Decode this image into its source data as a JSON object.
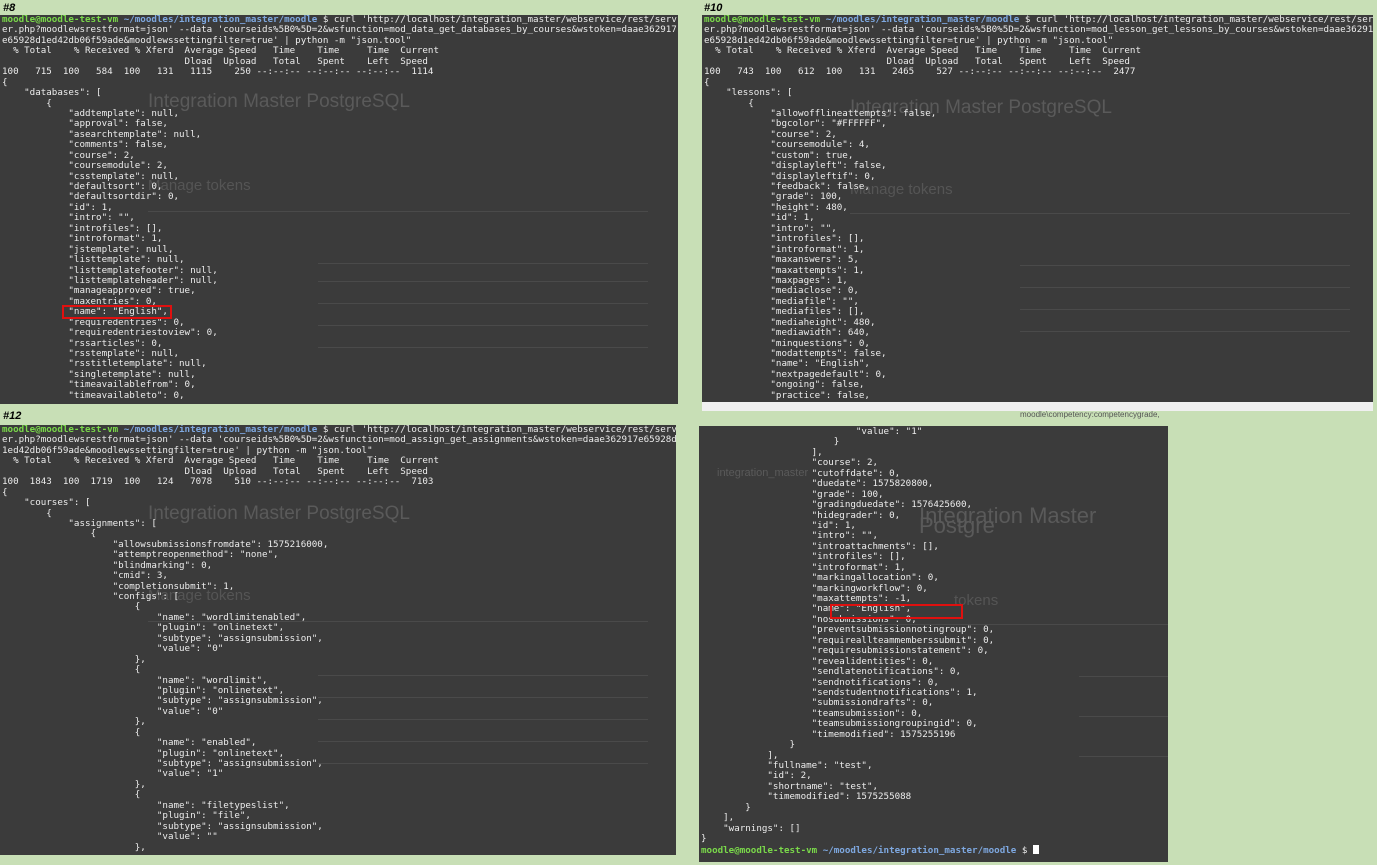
{
  "captions": {
    "p8": "#8",
    "p10": "#10",
    "p12": "#12"
  },
  "ghost": {
    "title": "Integration Master PostgreSQL",
    "heading": "Manage tokens",
    "title_short": "Integration Master Postgre",
    "heading_short": "tokens",
    "site_name": "integration_master",
    "strip_text": "moodle\\competency:competencygrade,"
  },
  "panels": {
    "p8": {
      "lines": [
        {
          "type": "prompt",
          "user": "moodle@moodle-test-vm",
          "path": "~/moodles/integration_master/moodle",
          "cmd": " $ curl 'http://localhost/integration_master/webservice/rest/serv"
        },
        {
          "text": "er.php?moodlewsrestformat=json' --data 'courseids%5B0%5D=2&wsfunction=mod_data_get_databases_by_courses&wstoken=daae362917"
        },
        {
          "text": "e65928d1ed42db06f59ade&moodlewssettingfilter=true' | python -m \"json.tool\""
        },
        {
          "text": "  % Total    % Received % Xferd  Average Speed   Time    Time     Time  Current"
        },
        {
          "text": "                                 Dload  Upload   Total   Spent    Left  Speed"
        },
        {
          "text": "100   715  100   584  100   131   1115    250 --:--:-- --:--:-- --:--:--  1114"
        },
        {
          "text": "{"
        },
        {
          "text": "    \"databases\": ["
        },
        {
          "text": "        {"
        },
        {
          "text": "            \"addtemplate\": null,"
        },
        {
          "text": "            \"approval\": false,"
        },
        {
          "text": "            \"asearchtemplate\": null,"
        },
        {
          "text": "            \"comments\": false,"
        },
        {
          "text": "            \"course\": 2,"
        },
        {
          "text": "            \"coursemodule\": 2,"
        },
        {
          "text": "            \"csstemplate\": null,"
        },
        {
          "text": "            \"defaultsort\": 0,"
        },
        {
          "text": "            \"defaultsortdir\": 0,"
        },
        {
          "text": "            \"id\": 1,"
        },
        {
          "text": "            \"intro\": \"\","
        },
        {
          "text": "            \"introfiles\": [],"
        },
        {
          "text": "            \"introformat\": 1,"
        },
        {
          "text": "            \"jstemplate\": null,"
        },
        {
          "text": "            \"listtemplate\": null,"
        },
        {
          "text": "            \"listtemplatefooter\": null,"
        },
        {
          "text": "            \"listtemplateheader\": null,"
        },
        {
          "text": "            \"manageapproved\": true,"
        },
        {
          "text": "            \"maxentries\": 0,"
        },
        {
          "text": "            \"name\": \"English\","
        },
        {
          "text": "            \"requiredentries\": 0,"
        },
        {
          "text": "            \"requiredentriestoview\": 0,"
        },
        {
          "text": "            \"rssarticles\": 0,"
        },
        {
          "text": "            \"rsstemplate\": null,"
        },
        {
          "text": "            \"rsstitletemplate\": null,"
        },
        {
          "text": "            \"singletemplate\": null,"
        },
        {
          "text": "            \"timeavailablefrom\": 0,"
        },
        {
          "text": "            \"timeavailableto\": 0,"
        }
      ]
    },
    "p10": {
      "lines": [
        {
          "type": "prompt",
          "user": "moodle@moodle-test-vm",
          "path": "~/moodles/integration_master/moodle",
          "cmd": " $ curl 'http://localhost/integration_master/webservice/rest/serv"
        },
        {
          "text": "er.php?moodlewsrestformat=json' --data 'courseids%5B0%5D=2&wsfunction=mod_lesson_get_lessons_by_courses&wstoken=daae362917"
        },
        {
          "text": "e65928d1ed42db06f59ade&moodlewssettingfilter=true' | python -m \"json.tool\""
        },
        {
          "text": "  % Total    % Received % Xferd  Average Speed   Time    Time     Time  Current"
        },
        {
          "text": "                                 Dload  Upload   Total   Spent    Left  Speed"
        },
        {
          "text": "100   743  100   612  100   131   2465    527 --:--:-- --:--:-- --:--:--  2477"
        },
        {
          "text": "{"
        },
        {
          "text": "    \"lessons\": ["
        },
        {
          "text": "        {"
        },
        {
          "text": "            \"allowofflineattempts\": false,"
        },
        {
          "text": "            \"bgcolor\": \"#FFFFFF\","
        },
        {
          "text": "            \"course\": 2,"
        },
        {
          "text": "            \"coursemodule\": 4,"
        },
        {
          "text": "            \"custom\": true,"
        },
        {
          "text": "            \"displayleft\": false,"
        },
        {
          "text": "            \"displayleftif\": 0,"
        },
        {
          "text": "            \"feedback\": false,"
        },
        {
          "text": "            \"grade\": 100,"
        },
        {
          "text": "            \"height\": 480,"
        },
        {
          "text": "            \"id\": 1,"
        },
        {
          "text": "            \"intro\": \"\","
        },
        {
          "text": "            \"introfiles\": [],"
        },
        {
          "text": "            \"introformat\": 1,"
        },
        {
          "text": "            \"maxanswers\": 5,"
        },
        {
          "text": "            \"maxattempts\": 1,"
        },
        {
          "text": "            \"maxpages\": 1,"
        },
        {
          "text": "            \"mediaclose\": 0,"
        },
        {
          "text": "            \"mediafile\": \"\","
        },
        {
          "text": "            \"mediafiles\": [],"
        },
        {
          "text": "            \"mediaheight\": 480,"
        },
        {
          "text": "            \"mediawidth\": 640,"
        },
        {
          "text": "            \"minquestions\": 0,"
        },
        {
          "text": "            \"modattempts\": false,"
        },
        {
          "text": "            \"name\": \"English\","
        },
        {
          "text": "            \"nextpagedefault\": 0,"
        },
        {
          "text": "            \"ongoing\": false,"
        },
        {
          "text": "            \"practice\": false,"
        }
      ]
    },
    "p12": {
      "lines": [
        {
          "type": "prompt",
          "user": "moodle@moodle-test-vm",
          "path": "~/moodles/integration_master/moodle",
          "cmd": " $ curl 'http://localhost/integration_master/webservice/rest/serv"
        },
        {
          "text": "er.php?moodlewsrestformat=json' --data 'courseids%5B0%5D=2&wsfunction=mod_assign_get_assignments&wstoken=daae362917e65928d"
        },
        {
          "text": "1ed42db06f59ade&moodlewssettingfilter=true' | python -m \"json.tool\""
        },
        {
          "text": "  % Total    % Received % Xferd  Average Speed   Time    Time     Time  Current"
        },
        {
          "text": "                                 Dload  Upload   Total   Spent    Left  Speed"
        },
        {
          "text": "100  1843  100  1719  100   124   7078    510 --:--:-- --:--:-- --:--:--  7103"
        },
        {
          "text": "{"
        },
        {
          "text": "    \"courses\": ["
        },
        {
          "text": "        {"
        },
        {
          "text": "            \"assignments\": ["
        },
        {
          "text": "                {"
        },
        {
          "text": "                    \"allowsubmissionsfromdate\": 1575216000,"
        },
        {
          "text": "                    \"attemptreopenmethod\": \"none\","
        },
        {
          "text": "                    \"blindmarking\": 0,"
        },
        {
          "text": "                    \"cmid\": 3,"
        },
        {
          "text": "                    \"completionsubmit\": 1,"
        },
        {
          "text": "                    \"configs\": ["
        },
        {
          "text": "                        {"
        },
        {
          "text": "                            \"name\": \"wordlimitenabled\","
        },
        {
          "text": "                            \"plugin\": \"onlinetext\","
        },
        {
          "text": "                            \"subtype\": \"assignsubmission\","
        },
        {
          "text": "                            \"value\": \"0\""
        },
        {
          "text": "                        },"
        },
        {
          "text": "                        {"
        },
        {
          "text": "                            \"name\": \"wordlimit\","
        },
        {
          "text": "                            \"plugin\": \"onlinetext\","
        },
        {
          "text": "                            \"subtype\": \"assignsubmission\","
        },
        {
          "text": "                            \"value\": \"0\""
        },
        {
          "text": "                        },"
        },
        {
          "text": "                        {"
        },
        {
          "text": "                            \"name\": \"enabled\","
        },
        {
          "text": "                            \"plugin\": \"onlinetext\","
        },
        {
          "text": "                            \"subtype\": \"assignsubmission\","
        },
        {
          "text": "                            \"value\": \"1\""
        },
        {
          "text": "                        },"
        },
        {
          "text": "                        {"
        },
        {
          "text": "                            \"name\": \"filetypeslist\","
        },
        {
          "text": "                            \"plugin\": \"file\","
        },
        {
          "text": "                            \"subtype\": \"assignsubmission\","
        },
        {
          "text": "                            \"value\": \"\""
        },
        {
          "text": "                        },"
        }
      ]
    },
    "p12b": {
      "lines": [
        {
          "text": "                            \"value\": \"1\""
        },
        {
          "text": "                        }"
        },
        {
          "text": "                    ],"
        },
        {
          "text": "                    \"course\": 2,"
        },
        {
          "text": "                    \"cutoffdate\": 0,"
        },
        {
          "text": "                    \"duedate\": 1575820800,"
        },
        {
          "text": "                    \"grade\": 100,"
        },
        {
          "text": "                    \"gradingduedate\": 1576425600,"
        },
        {
          "text": "                    \"hidegrader\": 0,"
        },
        {
          "text": "                    \"id\": 1,"
        },
        {
          "text": "                    \"intro\": \"\","
        },
        {
          "text": "                    \"introattachments\": [],"
        },
        {
          "text": "                    \"introfiles\": [],"
        },
        {
          "text": "                    \"introformat\": 1,"
        },
        {
          "text": "                    \"markingallocation\": 0,"
        },
        {
          "text": "                    \"markingworkflow\": 0,"
        },
        {
          "text": "                    \"maxattempts\": -1,"
        },
        {
          "text": "                    \"name\": \"English\","
        },
        {
          "text": "                    \"nosubmissions\": 0,"
        },
        {
          "text": "                    \"preventsubmissionnotingroup\": 0,"
        },
        {
          "text": "                    \"requireallteammemberssubmit\": 0,"
        },
        {
          "text": "                    \"requiresubmissionstatement\": 0,"
        },
        {
          "text": "                    \"revealidentities\": 0,"
        },
        {
          "text": "                    \"sendlatenotifications\": 0,"
        },
        {
          "text": "                    \"sendnotifications\": 0,"
        },
        {
          "text": "                    \"sendstudentnotifications\": 1,"
        },
        {
          "text": "                    \"submissiondrafts\": 0,"
        },
        {
          "text": "                    \"teamsubmission\": 0,"
        },
        {
          "text": "                    \"teamsubmissiongroupingid\": 0,"
        },
        {
          "text": "                    \"timemodified\": 1575255196"
        },
        {
          "text": "                }"
        },
        {
          "text": "            ],"
        },
        {
          "text": "            \"fullname\": \"test\","
        },
        {
          "text": "            \"id\": 2,"
        },
        {
          "text": "            \"shortname\": \"test\","
        },
        {
          "text": "            \"timemodified\": 1575255088"
        },
        {
          "text": "        }"
        },
        {
          "text": "    ],"
        },
        {
          "text": "    \"warnings\": []"
        },
        {
          "text": "}"
        },
        {
          "type": "prompt",
          "user": "moodle@moodle-test-vm",
          "path": "~/moodles/integration_master/moodle",
          "cmd": " $ ",
          "cursor": true
        }
      ]
    }
  },
  "colors": {
    "highlight": "#e0100f",
    "background": "#c8dfb6",
    "terminal": "#3b3b3b"
  }
}
